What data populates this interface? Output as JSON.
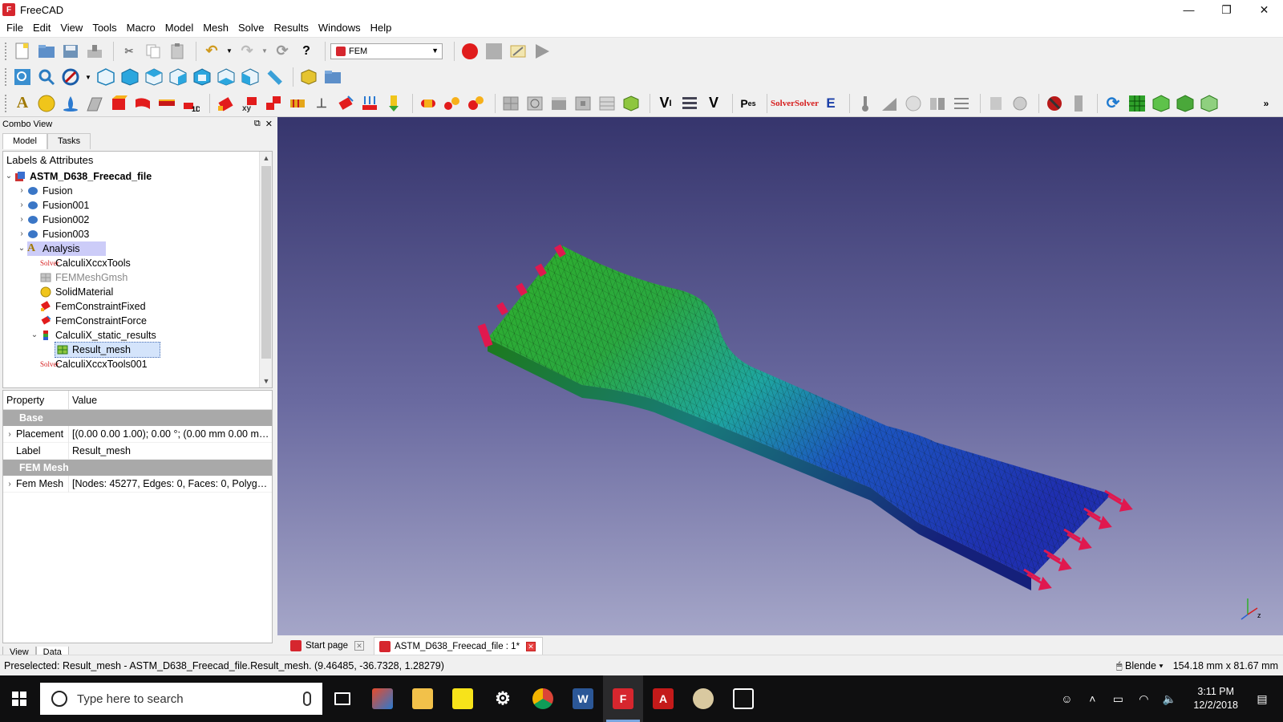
{
  "window": {
    "title": "FreeCAD",
    "controls": [
      "—",
      "❐",
      "✕"
    ]
  },
  "menu": [
    "File",
    "Edit",
    "View",
    "Tools",
    "Macro",
    "Model",
    "Mesh",
    "Solve",
    "Results",
    "Windows",
    "Help"
  ],
  "toolbar": {
    "workbench": "FEM"
  },
  "combo": {
    "title": "Combo View",
    "tabs": [
      "Model",
      "Tasks"
    ],
    "tree_header": "Labels & Attributes",
    "tree": {
      "document": "ASTM_D638_Freecad_file",
      "items": [
        "Fusion",
        "Fusion001",
        "Fusion002",
        "Fusion003"
      ],
      "analysis": "Analysis",
      "analysis_children": [
        "CalculiXccxTools",
        "FEMMeshGmsh",
        "SolidMaterial",
        "FemConstraintFixed",
        "FemConstraintForce"
      ],
      "results_group": "CalculiX_static_results",
      "result_mesh": "Result_mesh",
      "last": "CalculiXccxTools001"
    },
    "properties": {
      "col_property": "Property",
      "col_value": "Value",
      "group_base": "Base",
      "placement_label": "Placement",
      "placement_value": "[(0.00 0.00 1.00); 0.00 °; (0.00 mm  0.00 mm ...",
      "label_label": "Label",
      "label_value": "Result_mesh",
      "group_fem": "FEM  Mesh",
      "femmesh_label": "Fem Mesh",
      "femmesh_value": "[Nodes: 45277, Edges: 0, Faces: 0, Polygons..."
    },
    "bottom_tabs": [
      "View",
      "Data"
    ]
  },
  "doc_tabs": [
    "Start page",
    "ASTM_D638_Freecad_file : 1*"
  ],
  "status": {
    "preselected": "Preselected: Result_mesh - ASTM_D638_Freecad_file.Result_mesh. (9.46485, -36.7328, 1.28279)",
    "nav_style": "Blende",
    "dimensions": "154.18 mm x 81.67 mm"
  },
  "taskbar": {
    "search_placeholder": "Type here to search",
    "time": "3:11 PM",
    "date": "12/2/2018"
  },
  "colors": {
    "accent_red": "#d6262e",
    "mesh_green": "#2fae2a",
    "mesh_blue": "#1f37b8",
    "viewport_top": "#36356d",
    "viewport_bottom": "#a5a6c8"
  }
}
